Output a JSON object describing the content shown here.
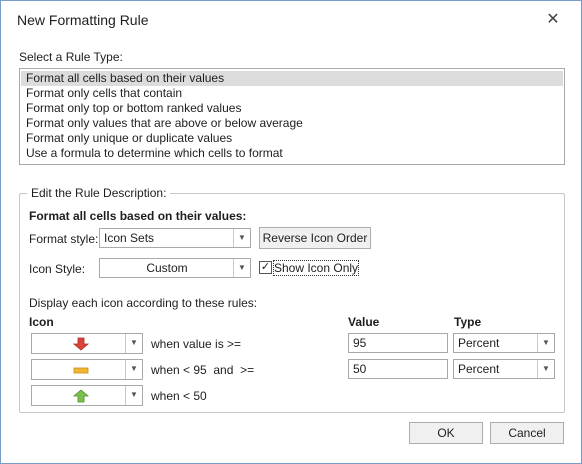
{
  "window": {
    "title": "New Formatting Rule",
    "close_glyph": "✕"
  },
  "rule_type": {
    "label": "Select a Rule Type:",
    "items": [
      "Format all cells based on their values",
      "Format only cells that contain",
      "Format only top or bottom ranked values",
      "Format only values that are above or below average",
      "Format only unique or duplicate values",
      "Use a formula to determine which cells to format"
    ],
    "selected_index": 0
  },
  "description": {
    "group_label": "Edit the Rule Description:",
    "heading": "Format all cells based on their values:",
    "format_style_label": "Format style:",
    "format_style_value": "Icon Sets",
    "reverse_button": "Reverse Icon Order",
    "icon_style_label": "Icon Style:",
    "icon_style_value": "Custom",
    "show_icon_only_label": "Show Icon Only",
    "show_icon_only_checked": true,
    "rules_caption": "Display each icon according to these rules:",
    "col_icon": "Icon",
    "col_value": "Value",
    "col_type": "Type",
    "rules": [
      {
        "icon": "red-down-arrow-icon",
        "condition": "when value is >=",
        "value": "95",
        "type": "Percent"
      },
      {
        "icon": "yellow-dash-icon",
        "condition": "when < 95  and  >=",
        "value": "50",
        "type": "Percent"
      },
      {
        "icon": "green-up-arrow-icon",
        "condition": "when < 50",
        "value": "",
        "type": ""
      }
    ]
  },
  "buttons": {
    "ok": "OK",
    "cancel": "Cancel"
  },
  "colors": {
    "red": "#d9443a",
    "yellow": "#f2b635",
    "green": "#7cc04b",
    "border": "#7a9ccd"
  }
}
